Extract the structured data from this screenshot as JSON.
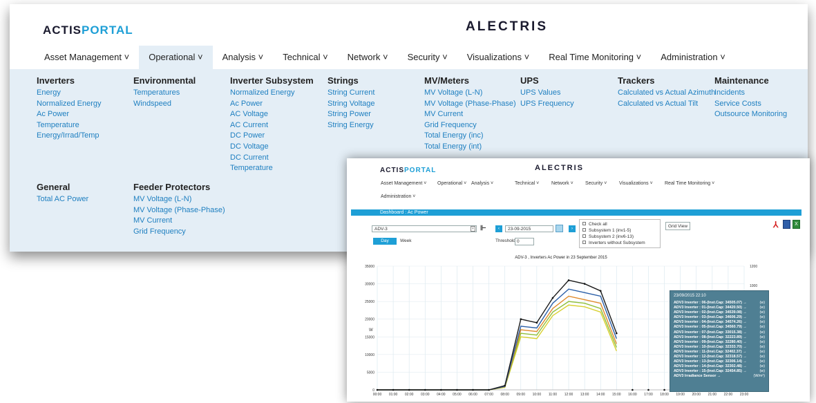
{
  "back_window": {
    "logo": {
      "part1": "ACTIS",
      "part2": "PORTAL"
    },
    "brand": "ALECTRIS",
    "nav": [
      {
        "label": "Asset Management ˅"
      },
      {
        "label": "Operational ˅"
      },
      {
        "label": "Analysis ˅"
      },
      {
        "label": "Technical ˅"
      },
      {
        "label": "Network ˅"
      },
      {
        "label": "Security ˅"
      },
      {
        "label": "Visualizations ˅"
      },
      {
        "label": "Real Time Monitoring ˅"
      },
      {
        "label": "Administration ˅"
      }
    ],
    "menu": {
      "inverters": {
        "title": "Inverters",
        "items": [
          "Energy",
          "Normalized Energy",
          "Ac Power",
          "Temperature",
          "Energy/Irrad/Temp"
        ]
      },
      "environmental": {
        "title": "Environmental",
        "items": [
          "Temperatures",
          "Windspeed"
        ]
      },
      "inverter_subsystem": {
        "title": "Inverter Subsystem",
        "items": [
          "Normalized Energy",
          "Ac Power",
          "AC Voltage",
          "AC Current",
          "DC Power",
          "DC Voltage",
          "DC Current",
          "Temperature"
        ]
      },
      "strings": {
        "title": "Strings",
        "items": [
          "String Current",
          "String Voltage",
          "String Power",
          "String Energy"
        ]
      },
      "mv_meters": {
        "title": "MV/Meters",
        "items": [
          "MV Voltage (L-N)",
          "MV Voltage (Phase-Phase)",
          "MV Current",
          "Grid Frequency",
          "Total Energy (inc)",
          "Total Energy (int)"
        ]
      },
      "ups": {
        "title": "UPS",
        "items": [
          "UPS Values",
          "UPS Frequency"
        ]
      },
      "trackers": {
        "title": "Trackers",
        "items": [
          "Calculated vs Actual Azimuth",
          "Calculated vs Actual Tilt"
        ]
      },
      "maintenance": {
        "title": "Maintenance",
        "items": [
          "Incidents",
          "Service Costs",
          "Outsource Monitoring"
        ]
      },
      "general": {
        "title": "General",
        "items": [
          "Total AC Power"
        ]
      },
      "feeder_protectors": {
        "title": "Feeder Protectors",
        "items": [
          "MV Voltage (L-N)",
          "MV Voltage (Phase-Phase)",
          "MV Current",
          "Grid Frequency"
        ]
      }
    }
  },
  "front_window": {
    "logo": {
      "part1": "ACTIS",
      "part2": "PORTAL"
    },
    "brand": "ALECTRIS",
    "nav": [
      "Asset Management ˅",
      "Operational ˅",
      "Analysis ˅",
      "Technical ˅",
      "Network ˅",
      "Security ˅",
      "Visualizations ˅",
      "Real Time Monitoring ˅"
    ],
    "nav2": "Administration ˅",
    "breadcrumb": "Dashboard : Ac Power",
    "asset_select": "ADV-3",
    "date_value": "23-09-2015",
    "day_tab": "Day",
    "week_tab": "Week",
    "threshold_label": "Threshold",
    "threshold_value": "0",
    "checks": [
      "Check all",
      "Subsystem 1 (inv1-5)",
      "Subsystem 2 (inv6-13)",
      "Inverters without Subsystem"
    ],
    "grid_view": "Grid View",
    "export_icons": [
      "pdf-icon",
      "word-icon",
      "excel-icon"
    ],
    "colors": {
      "accent": "#1e9fd6",
      "tooltip": "#4f7f93"
    }
  },
  "chart_data": {
    "type": "line",
    "title": "ADV-3 , Inverters Ac Power in 23 September 2015",
    "ylabel": "W",
    "ylim": [
      0,
      35000
    ],
    "y_ticks": [
      "35000",
      "30000",
      "25000",
      "20000",
      "15000",
      "10000",
      "5000",
      "0"
    ],
    "y2_ticks": [
      "1200",
      "1000"
    ],
    "x": [
      "00:00",
      "01:00",
      "02:00",
      "03:00",
      "04:00",
      "05:00",
      "06:00",
      "07:00",
      "08:00",
      "09:00",
      "10:00",
      "11:00",
      "12:00",
      "13:00",
      "14:00",
      "15:00",
      "16:00",
      "17:00",
      "18:00",
      "19:00",
      "20:00",
      "21:00",
      "22:00",
      "23:00"
    ],
    "series": [
      {
        "color": "#1a1a1a",
        "values": [
          0,
          0,
          0,
          0,
          0,
          0,
          0,
          0,
          1200,
          20000,
          19000,
          26000,
          31000,
          30000,
          28000,
          16000
        ]
      },
      {
        "color": "#2b5fa8",
        "values": [
          0,
          0,
          0,
          0,
          0,
          0,
          0,
          0,
          1000,
          18000,
          17500,
          24500,
          28500,
          27500,
          26500,
          14500
        ]
      },
      {
        "color": "#e08a2a",
        "values": [
          0,
          0,
          0,
          0,
          0,
          0,
          0,
          0,
          900,
          17000,
          16500,
          23000,
          26500,
          25500,
          24500,
          13000
        ]
      },
      {
        "color": "#8fbf3a",
        "values": [
          0,
          0,
          0,
          0,
          0,
          0,
          0,
          0,
          800,
          16000,
          15500,
          22000,
          25000,
          24500,
          23000,
          12000
        ]
      },
      {
        "color": "#d8d030",
        "values": [
          0,
          0,
          0,
          0,
          0,
          0,
          0,
          0,
          700,
          15000,
          14500,
          21000,
          24000,
          23500,
          22000,
          11000
        ]
      }
    ],
    "tooltip": {
      "header": "23/09/2015 22:10",
      "rows": [
        {
          "label": "ADV3 Inverter : 06-(Inst.Cap: 34505.07) →",
          "unit": "(w)"
        },
        {
          "label": "ADV3 Inverter : 01-(Inst.Cap: 34420.50) →",
          "unit": "(w)"
        },
        {
          "label": "ADV3 Inverter : 02-(Inst.Cap: 34539.08) →",
          "unit": "(w)"
        },
        {
          "label": "ADV3 Inverter : 03-(Inst.Cap: 34606.29) →",
          "unit": "(w)"
        },
        {
          "label": "ADV3 Inverter : 04-(Inst.Cap: 34574.26) →",
          "unit": "(w)"
        },
        {
          "label": "ADV3 Inverter : 05-(Inst.Cap: 34560.79) →",
          "unit": "(w)"
        },
        {
          "label": "ADV3 Inverter : 07-(Inst.Cap: 33015.38) →",
          "unit": "(w)"
        },
        {
          "label": "ADV3 Inverter : 08-(Inst.Cap: 32223.89) →",
          "unit": "(w)"
        },
        {
          "label": "ADV3 Inverter : 09-(Inst.Cap: 32280.40) →",
          "unit": "(w)"
        },
        {
          "label": "ADV3 Inverter : 10-(Inst.Cap: 32333.70) →",
          "unit": "(w)"
        },
        {
          "label": "ADV3 Inverter : 11-(Inst.Cap: 32402.37) →",
          "unit": "(w)"
        },
        {
          "label": "ADV3 Inverter : 12-(Inst.Cap: 32318.57) →",
          "unit": "(w)"
        },
        {
          "label": "ADV3 Inverter : 13-(Inst.Cap: 32306.14) →",
          "unit": "(w)"
        },
        {
          "label": "ADV3 Inverter : 14-(Inst.Cap: 32302.48) →",
          "unit": "(w)"
        },
        {
          "label": "ADV3 Inverter : 15-(Inst.Cap: 32454.85) →",
          "unit": "(w)"
        },
        {
          "label": "ADV3 Irradiance Sensor →",
          "unit": "(W/m²)"
        }
      ]
    }
  }
}
